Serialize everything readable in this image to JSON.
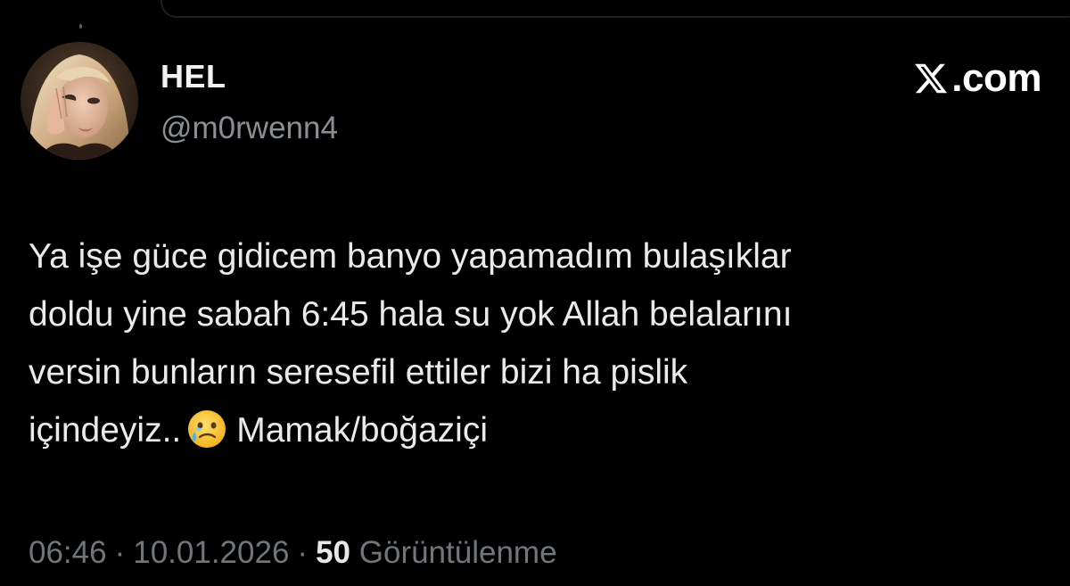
{
  "header": {
    "display_name": "HEL",
    "handle": "@m0rwenn4",
    "brand": ".com",
    "brand_icon": "x-logo-icon"
  },
  "tweet": {
    "lines": [
      "Ya işe güce gidicem banyo yapamadım bulaşıklar",
      "doldu yine sabah 6:45 hala su yok Allah belalarını",
      "versin bunların seresefil ettiler bizi ha pislik"
    ],
    "last_line_before_emoji": "içindeyiz..",
    "emoji": "face-holding-back-tears-icon",
    "last_line_after_emoji": "Mamak/boğaziçi"
  },
  "meta": {
    "time": "06:46",
    "separator": "·",
    "date": "10.01.2026",
    "views_count": "50",
    "views_label": "Görüntülenme"
  },
  "colors": {
    "background": "#000000",
    "text_primary": "#e7e9ea",
    "text_secondary": "#71767b",
    "emoji_face": "#f8c22e"
  }
}
